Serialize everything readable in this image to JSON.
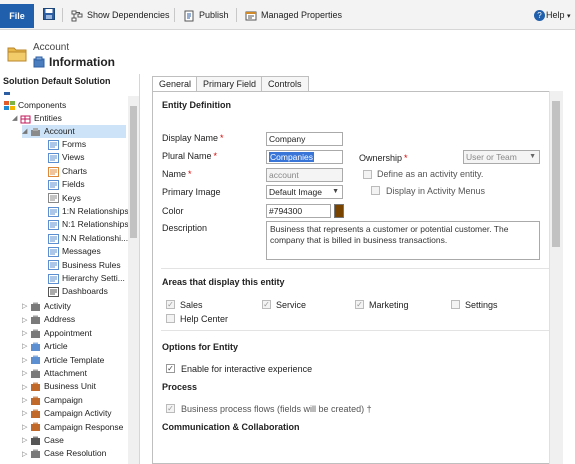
{
  "toolbar": {
    "file": "File",
    "show_dependencies": "Show Dependencies",
    "publish": "Publish",
    "managed_properties": "Managed Properties",
    "help": "Help",
    "help_caret": "▾"
  },
  "header": {
    "subtitle": "Account",
    "title": "Information"
  },
  "sidebar": {
    "title": "Solution Default Solution",
    "components": "Components",
    "entities": "Entities",
    "account": "Account",
    "account_children": [
      "Forms",
      "Views",
      "Charts",
      "Fields",
      "Keys",
      "1:N Relationships",
      "N:1 Relationships",
      "N:N Relationshi...",
      "Messages",
      "Business Rules",
      "Hierarchy Setti...",
      "Dashboards"
    ],
    "entities_list": [
      "Activity",
      "Address",
      "Appointment",
      "Article",
      "Article Template",
      "Attachment",
      "Business Unit",
      "Campaign",
      "Campaign Activity",
      "Campaign Response",
      "Case",
      "Case Resolution"
    ]
  },
  "tabs": [
    "General",
    "Primary Field",
    "Controls"
  ],
  "entity_definition": {
    "title": "Entity Definition",
    "display_name_label": "Display Name",
    "display_name_value": "Company",
    "plural_name_label": "Plural Name",
    "plural_name_value": "Companies",
    "name_label": "Name",
    "name_value": "account",
    "primary_image_label": "Primary Image",
    "primary_image_value": "Default Image",
    "color_label": "Color",
    "color_value": "#794300",
    "swatch_color": "#794300",
    "description_label": "Description",
    "description_value": "Business that represents a customer or potential customer. The company that is billed in business transactions.",
    "ownership_label": "Ownership",
    "ownership_value": "User or Team",
    "define_activity": "Define as an activity entity.",
    "display_activity_menus": "Display in Activity Menus",
    "required_mark": "*"
  },
  "areas": {
    "title": "Areas that display this entity",
    "items": [
      {
        "label": "Sales",
        "checked": true
      },
      {
        "label": "Service",
        "checked": true
      },
      {
        "label": "Marketing",
        "checked": true
      },
      {
        "label": "Settings",
        "checked": false
      },
      {
        "label": "Help Center",
        "checked": false
      }
    ]
  },
  "options": {
    "title": "Options for Entity",
    "interactive": "Enable for interactive experience"
  },
  "process": {
    "title": "Process",
    "bpf": "Business process flows (fields will be created) †"
  },
  "communication": {
    "title": "Communication & Collaboration"
  },
  "check_glyph": "✓"
}
